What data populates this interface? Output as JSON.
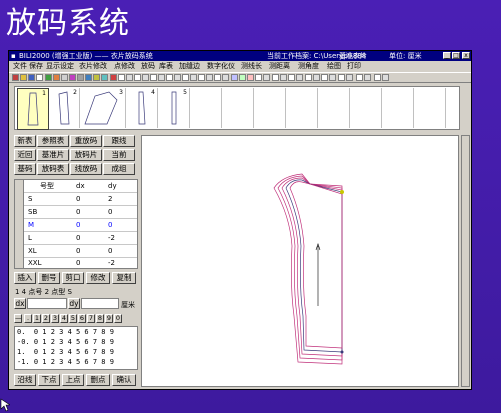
{
  "slide_title": "放码系统",
  "window": {
    "title": "BILI2000 (增强工业版) —— 衣片放码系统",
    "current_file": "当前工作档案: C:\\Userypt\\888",
    "base_piece": "基准衣片",
    "unit": "单位: 厘米",
    "min_btn": "_",
    "max_btn": "□",
    "close_btn": "x"
  },
  "menu": [
    "文件",
    "保存",
    "显示设定",
    "衣片修改",
    "点修改",
    "放码",
    "库表",
    "加缝边",
    "数字化仪",
    "测线长",
    "测距离",
    "测角度",
    "绘图",
    "打印"
  ],
  "thumbnails": [
    "1",
    "2",
    "3",
    "4",
    "5"
  ],
  "buttons_row1": [
    "新表",
    "参照表",
    "重放码",
    "跟线"
  ],
  "buttons_row2": [
    "近回",
    "基准片",
    "放码片",
    "当前"
  ],
  "buttons_row3": [
    "基码",
    "放码表",
    "线放码",
    "成组"
  ],
  "size_table": {
    "headers": [
      "号型",
      "dx",
      "dy"
    ],
    "rows": [
      {
        "size": "S",
        "dx": "0",
        "dy": "2"
      },
      {
        "size": "SB",
        "dx": "0",
        "dy": "0"
      },
      {
        "size": "M",
        "dx": "0",
        "dy": "0"
      },
      {
        "size": "L",
        "dx": "0",
        "dy": "-2"
      },
      {
        "size": "XL",
        "dx": "0",
        "dy": "0"
      },
      {
        "size": "XXL",
        "dx": "0",
        "dy": "-2"
      }
    ],
    "highlight_color": "#0000ff"
  },
  "edit_buttons": [
    "插入",
    "删号",
    "剪口",
    "修改",
    "复制"
  ],
  "point_info": "1 4  点号 2  点型 S",
  "dx_label": "dx",
  "dy_label": "dy",
  "unit_label": "厘米",
  "numpad": [
    "—",
    ".",
    "1",
    "2",
    "3",
    "4",
    "5",
    "6",
    "7",
    "8",
    "9",
    "0"
  ],
  "grid_rows": [
    "0.  0 1 2 3 4 5 6 7 8 9",
    "-0. 0 1 2 3 4 5 6 7 8 9",
    "1.  0 1 2 3 4 5 6 7 8 9",
    "-1. 0 1 2 3 4 5 6 7 8 9"
  ],
  "bottom_buttons": [
    "沿线",
    "下点",
    "上点",
    "删点",
    "确认"
  ],
  "colors": {
    "background": "#4a1fb5",
    "titlebar": "#000080",
    "pattern_base": "#3a3a7a",
    "pattern_grade": "#c0307a",
    "marker": "#c8c800"
  }
}
